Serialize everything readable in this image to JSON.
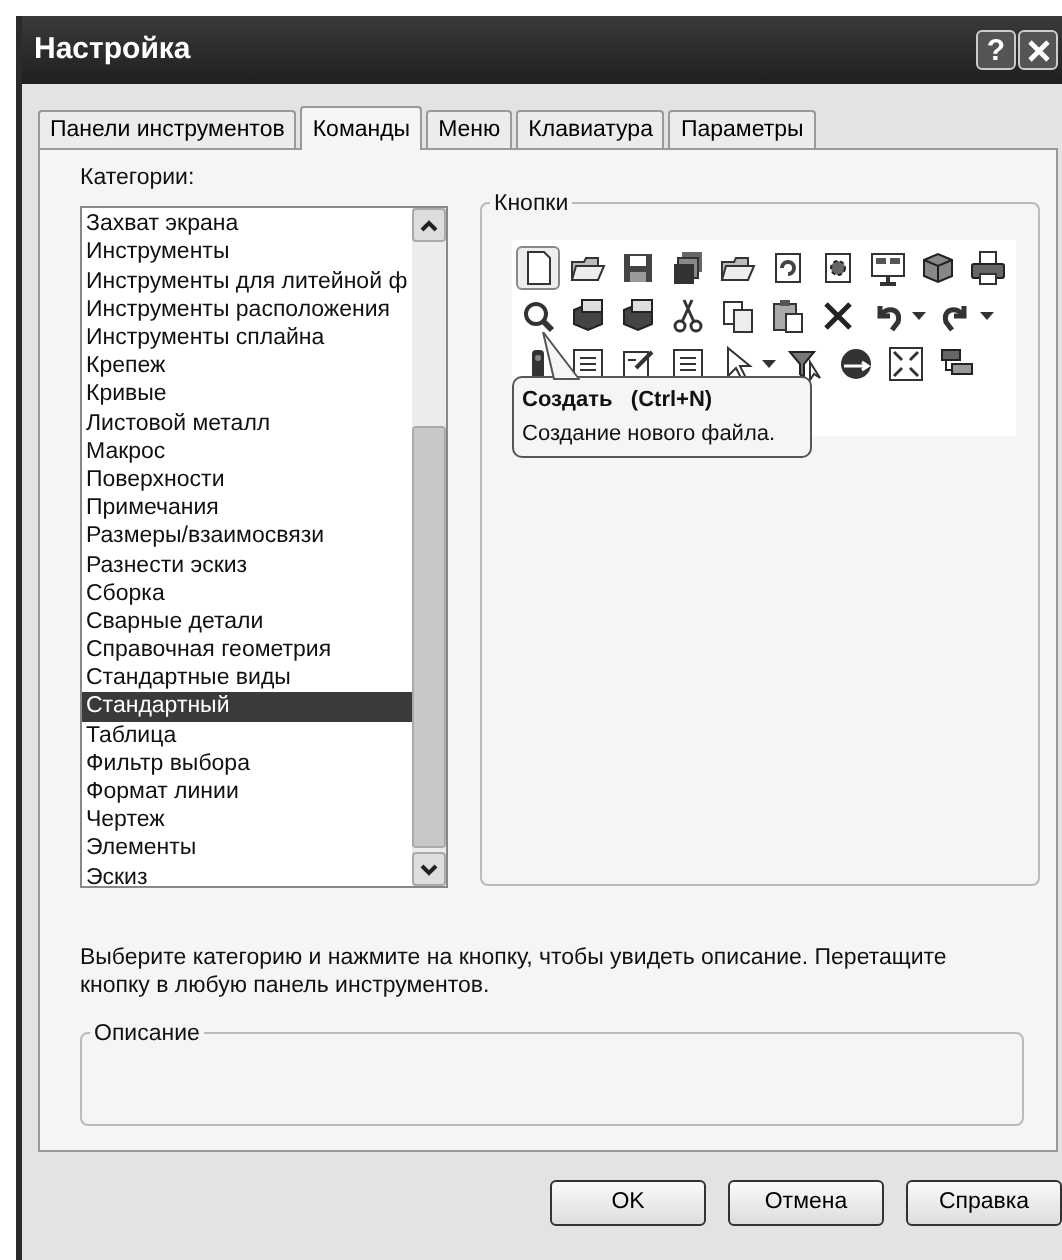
{
  "window": {
    "title": "Настройка"
  },
  "title_buttons": [
    {
      "kind": "help",
      "label": "?"
    },
    {
      "kind": "close"
    }
  ],
  "tabs": [
    {
      "label": "Панели инструментов",
      "selected": false
    },
    {
      "label": "Команды",
      "selected": true
    },
    {
      "label": "Меню",
      "selected": false
    },
    {
      "label": "Клавиатура",
      "selected": false
    },
    {
      "label": "Параметры",
      "selected": false
    }
  ],
  "categories": {
    "label": "Категории:",
    "items": [
      {
        "label": "Захват экрана",
        "selected": false
      },
      {
        "label": "Инструменты",
        "selected": false
      },
      {
        "label": "Инструменты для литейной ф",
        "selected": false
      },
      {
        "label": "Инструменты расположения",
        "selected": false
      },
      {
        "label": "Инструменты сплайна",
        "selected": false
      },
      {
        "label": "Крепеж",
        "selected": false
      },
      {
        "label": "Кривые",
        "selected": false
      },
      {
        "label": "Листовой металл",
        "selected": false
      },
      {
        "label": "Макрос",
        "selected": false
      },
      {
        "label": "Поверхности",
        "selected": false
      },
      {
        "label": "Примечания",
        "selected": false
      },
      {
        "label": "Размеры/взаимосвязи",
        "selected": false
      },
      {
        "label": "Разнести эскиз",
        "selected": false
      },
      {
        "label": "Сборка",
        "selected": false
      },
      {
        "label": "Сварные детали",
        "selected": false
      },
      {
        "label": "Справочная геометрия",
        "selected": false
      },
      {
        "label": "Стандартные виды",
        "selected": false
      },
      {
        "label": "Стандартный",
        "selected": true
      },
      {
        "label": "Таблица",
        "selected": false
      },
      {
        "label": "Фильтр выбора",
        "selected": false
      },
      {
        "label": "Формат линии",
        "selected": false
      },
      {
        "label": "Чертеж",
        "selected": false
      },
      {
        "label": "Элементы",
        "selected": false
      },
      {
        "label": "Эскиз",
        "selected": false
      }
    ]
  },
  "buttons_group": {
    "title": "Кнопки",
    "rows": [
      [
        {
          "kind": "document",
          "highlighted": true,
          "dropdown": false
        },
        {
          "kind": "folder",
          "highlighted": false,
          "dropdown": false
        },
        {
          "kind": "save",
          "highlighted": false,
          "dropdown": false
        },
        {
          "kind": "stack",
          "highlighted": false,
          "dropdown": false
        },
        {
          "kind": "folder",
          "highlighted": false,
          "dropdown": false
        },
        {
          "kind": "rebuild",
          "highlighted": false,
          "dropdown": false
        },
        {
          "kind": "gear",
          "highlighted": false,
          "dropdown": false
        },
        {
          "kind": "panel",
          "highlighted": false,
          "dropdown": false
        },
        {
          "kind": "box",
          "highlighted": false,
          "dropdown": false
        },
        {
          "kind": "printer",
          "highlighted": false,
          "dropdown": false
        }
      ],
      [
        {
          "kind": "magnifier",
          "highlighted": false,
          "dropdown": false
        },
        {
          "kind": "cube",
          "highlighted": false,
          "dropdown": false
        },
        {
          "kind": "cube",
          "highlighted": false,
          "dropdown": false
        },
        {
          "kind": "scissors",
          "highlighted": false,
          "dropdown": false
        },
        {
          "kind": "copy",
          "highlighted": false,
          "dropdown": false
        },
        {
          "kind": "paste",
          "highlighted": false,
          "dropdown": false
        },
        {
          "kind": "delete",
          "highlighted": false,
          "dropdown": false
        },
        {
          "kind": "undo",
          "highlighted": false,
          "dropdown": true
        },
        {
          "kind": "redo",
          "highlighted": false,
          "dropdown": true
        }
      ],
      [
        {
          "kind": "light",
          "highlighted": false,
          "dropdown": false
        },
        {
          "kind": "list",
          "highlighted": false,
          "dropdown": false
        },
        {
          "kind": "edit",
          "highlighted": false,
          "dropdown": false
        },
        {
          "kind": "list",
          "highlighted": false,
          "dropdown": false
        },
        {
          "kind": "pointer",
          "highlighted": false,
          "dropdown": true
        },
        {
          "kind": "filter",
          "highlighted": false,
          "dropdown": false
        },
        {
          "kind": "sphere",
          "highlighted": false,
          "dropdown": false
        },
        {
          "kind": "expand",
          "highlighted": false,
          "dropdown": false
        },
        {
          "kind": "layers",
          "highlighted": false,
          "dropdown": false
        }
      ]
    ]
  },
  "tooltip": {
    "title": "Создать",
    "shortcut": "(Ctrl+N)",
    "description": "Создание нового файла."
  },
  "hint": "Выберите категорию и нажмите на кнопку, чтобы увидеть описание. Перетащите кнопку в любую панель инструментов.",
  "description_group": {
    "title": "Описание"
  },
  "buttons": [
    "OK",
    "Отмена",
    "Справка"
  ]
}
